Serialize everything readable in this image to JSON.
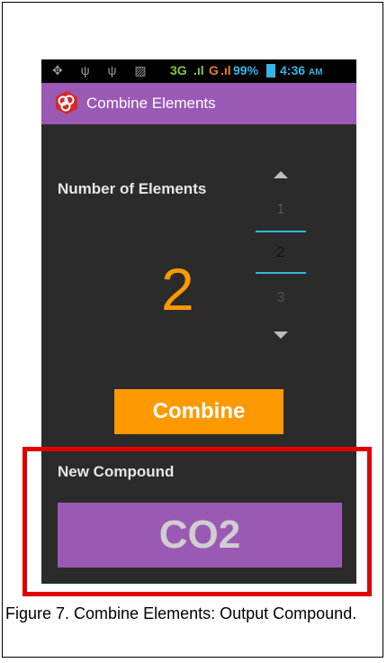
{
  "statusbar": {
    "left_icons": "✥ ψ ψ ▨",
    "network1": "3G",
    "bars1": ".ıl",
    "network2": "G",
    "bars2": ".ıl",
    "battery": "99%",
    "time": "4:36",
    "ampm": "AM"
  },
  "actionbar": {
    "title": "Combine Elements"
  },
  "picker": {
    "label": "Number of Elements",
    "display_value": "2",
    "prev_value": "1",
    "selected_value": "2",
    "next_value": "3"
  },
  "combine_button": {
    "label": "Combine"
  },
  "result": {
    "label": "New Compound",
    "value": "CO2"
  },
  "caption": {
    "text": "Figure 7. Combine Elements: Output Compound."
  },
  "colors": {
    "actionbar": "#9b59b6",
    "accent": "#ff9900",
    "highlight": "#e00000",
    "picker_line": "#33b5e5"
  }
}
